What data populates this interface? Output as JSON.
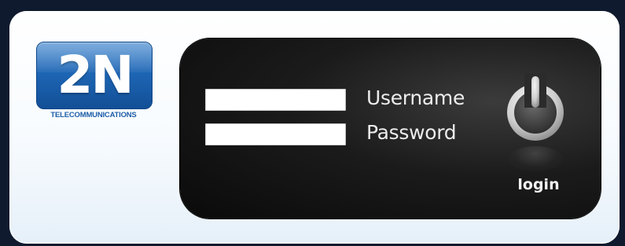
{
  "logo": {
    "mark": "2N",
    "tagline": "TELECOMMUNICATIONS",
    "color": "#1e66b5"
  },
  "login_form": {
    "username_label": "Username",
    "password_label": "Password",
    "username_value": "",
    "password_value": "",
    "login_label": "login",
    "power_icon": "power-icon"
  },
  "colors": {
    "panel": "#1b1b1b",
    "frame": "#ffffff",
    "accent": "#1e66b5"
  }
}
